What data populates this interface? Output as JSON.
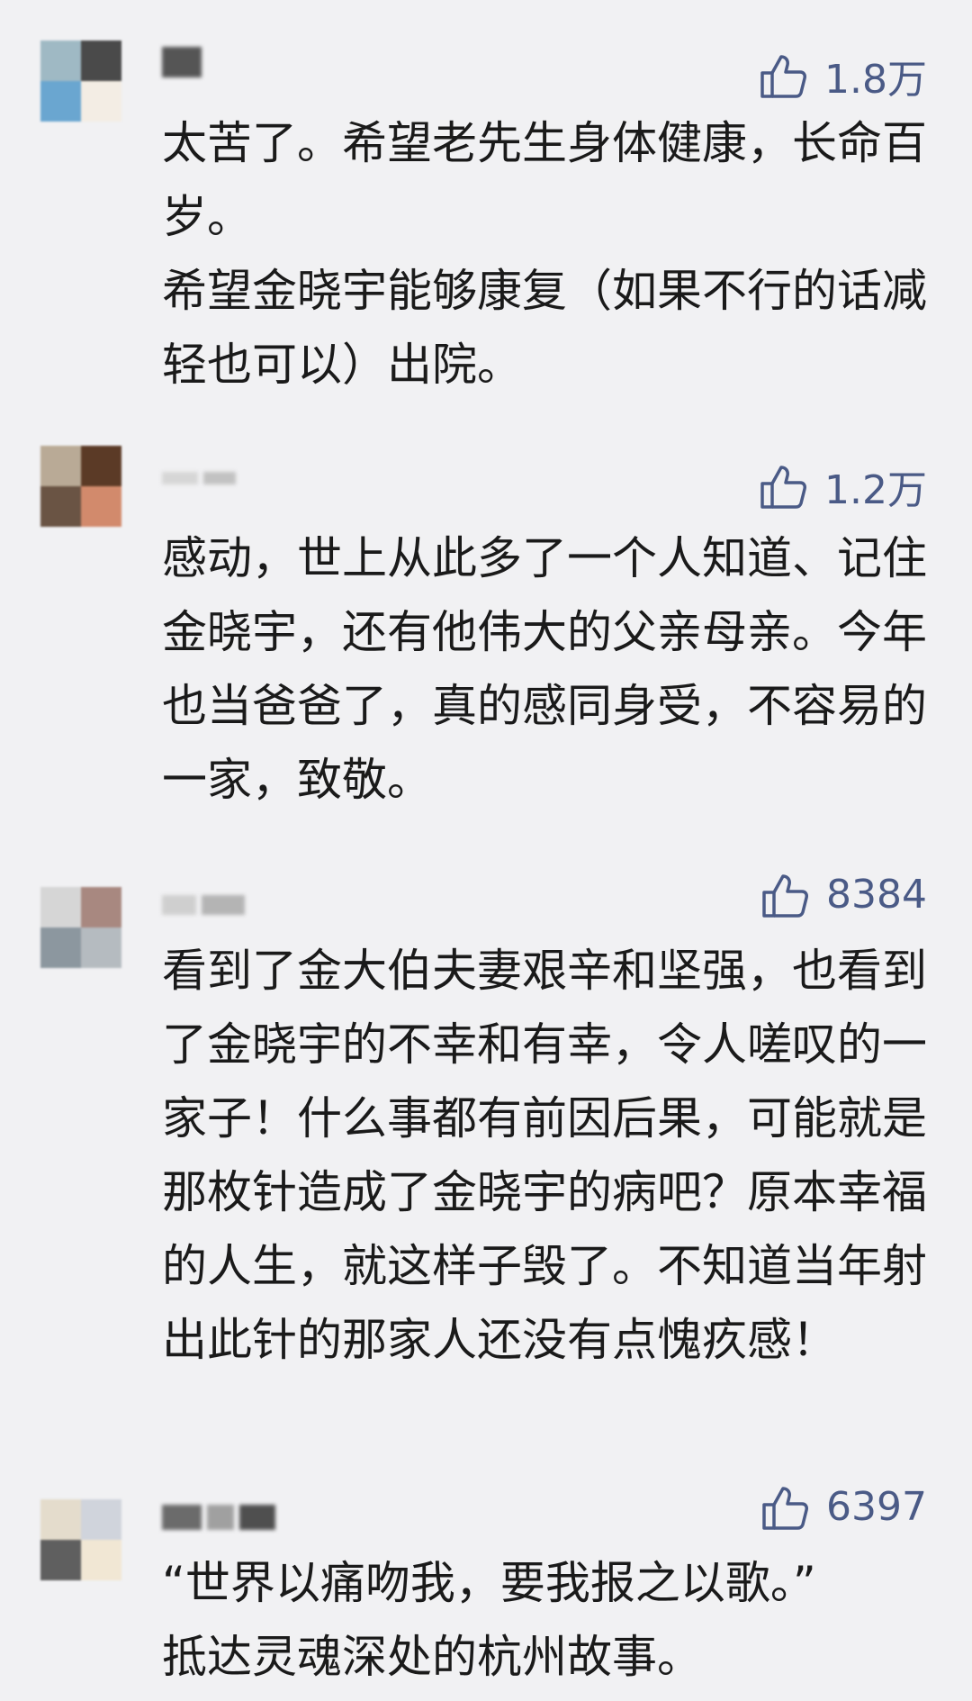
{
  "comments": [
    {
      "likes": "1.8万",
      "text": "太苦了。希望老先生身体健康，长命百岁。\n希望金晓宇能够康复（如果不行的话减轻也可以）出院。",
      "avatar_colors": [
        "#9fb9c4",
        "#4a4a4a",
        "#6aa6d0",
        "#f3ede4"
      ],
      "name_colors": [
        "#555555"
      ]
    },
    {
      "likes": "1.2万",
      "text": "感动，世上从此多了一个人知道、记住金晓宇，还有他伟大的父亲母亲。今年也当爸爸了，真的感同身受，不容易的一家，致敬。",
      "avatar_colors": [
        "#b9aa96",
        "#5b3a26",
        "#6a5444",
        "#d28a6c"
      ],
      "name_colors": [
        "#d6d6d6",
        "#c2c2c2"
      ]
    },
    {
      "likes": "8384",
      "text": "看到了金大伯夫妻艰辛和坚强，也看到了金晓宇的不幸和有幸，令人嗟叹的一家子！什么事都有前因后果，可能就是那枚针造成了金晓宇的病吧？原本幸福的人生，就这样子毁了。不知道当年射出此针的那家人还没有点愧疚感！",
      "avatar_colors": [
        "#d6d6d6",
        "#a88880",
        "#8c979f",
        "#b5bbc0"
      ],
      "name_colors": [
        "#cfcfcf",
        "#b4b4b4"
      ]
    },
    {
      "likes": "6397",
      "text": "“世界以痛吻我，要我报之以歌。”\n抵达灵魂深处的杭州故事。",
      "avatar_colors": [
        "#e4dccc",
        "#d0d4dc",
        "#5f5f5f",
        "#f1e7d4"
      ],
      "name_colors": [
        "#6b6b6b",
        "#a0a0a0",
        "#4f4f4f"
      ]
    }
  ]
}
